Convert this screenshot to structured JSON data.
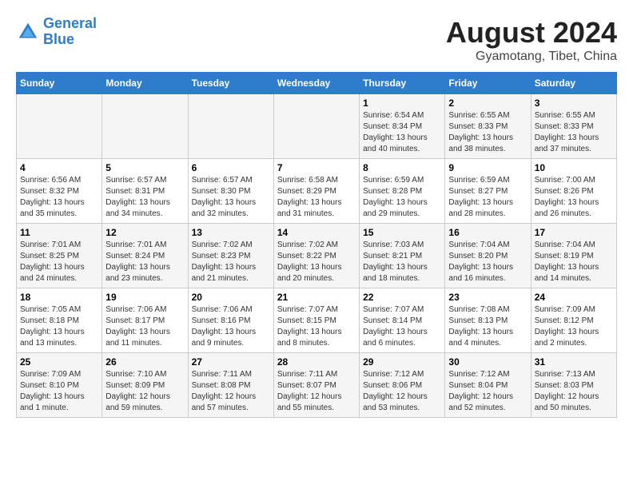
{
  "logo": {
    "line1": "General",
    "line2": "Blue"
  },
  "title": "August 2024",
  "subtitle": "Gyamotang, Tibet, China",
  "weekdays": [
    "Sunday",
    "Monday",
    "Tuesday",
    "Wednesday",
    "Thursday",
    "Friday",
    "Saturday"
  ],
  "weeks": [
    [
      {
        "day": "",
        "content": ""
      },
      {
        "day": "",
        "content": ""
      },
      {
        "day": "",
        "content": ""
      },
      {
        "day": "",
        "content": ""
      },
      {
        "day": "1",
        "content": "Sunrise: 6:54 AM\nSunset: 8:34 PM\nDaylight: 13 hours and 40 minutes."
      },
      {
        "day": "2",
        "content": "Sunrise: 6:55 AM\nSunset: 8:33 PM\nDaylight: 13 hours and 38 minutes."
      },
      {
        "day": "3",
        "content": "Sunrise: 6:55 AM\nSunset: 8:33 PM\nDaylight: 13 hours and 37 minutes."
      }
    ],
    [
      {
        "day": "4",
        "content": "Sunrise: 6:56 AM\nSunset: 8:32 PM\nDaylight: 13 hours and 35 minutes."
      },
      {
        "day": "5",
        "content": "Sunrise: 6:57 AM\nSunset: 8:31 PM\nDaylight: 13 hours and 34 minutes."
      },
      {
        "day": "6",
        "content": "Sunrise: 6:57 AM\nSunset: 8:30 PM\nDaylight: 13 hours and 32 minutes."
      },
      {
        "day": "7",
        "content": "Sunrise: 6:58 AM\nSunset: 8:29 PM\nDaylight: 13 hours and 31 minutes."
      },
      {
        "day": "8",
        "content": "Sunrise: 6:59 AM\nSunset: 8:28 PM\nDaylight: 13 hours and 29 minutes."
      },
      {
        "day": "9",
        "content": "Sunrise: 6:59 AM\nSunset: 8:27 PM\nDaylight: 13 hours and 28 minutes."
      },
      {
        "day": "10",
        "content": "Sunrise: 7:00 AM\nSunset: 8:26 PM\nDaylight: 13 hours and 26 minutes."
      }
    ],
    [
      {
        "day": "11",
        "content": "Sunrise: 7:01 AM\nSunset: 8:25 PM\nDaylight: 13 hours and 24 minutes."
      },
      {
        "day": "12",
        "content": "Sunrise: 7:01 AM\nSunset: 8:24 PM\nDaylight: 13 hours and 23 minutes."
      },
      {
        "day": "13",
        "content": "Sunrise: 7:02 AM\nSunset: 8:23 PM\nDaylight: 13 hours and 21 minutes."
      },
      {
        "day": "14",
        "content": "Sunrise: 7:02 AM\nSunset: 8:22 PM\nDaylight: 13 hours and 20 minutes."
      },
      {
        "day": "15",
        "content": "Sunrise: 7:03 AM\nSunset: 8:21 PM\nDaylight: 13 hours and 18 minutes."
      },
      {
        "day": "16",
        "content": "Sunrise: 7:04 AM\nSunset: 8:20 PM\nDaylight: 13 hours and 16 minutes."
      },
      {
        "day": "17",
        "content": "Sunrise: 7:04 AM\nSunset: 8:19 PM\nDaylight: 13 hours and 14 minutes."
      }
    ],
    [
      {
        "day": "18",
        "content": "Sunrise: 7:05 AM\nSunset: 8:18 PM\nDaylight: 13 hours and 13 minutes."
      },
      {
        "day": "19",
        "content": "Sunrise: 7:06 AM\nSunset: 8:17 PM\nDaylight: 13 hours and 11 minutes."
      },
      {
        "day": "20",
        "content": "Sunrise: 7:06 AM\nSunset: 8:16 PM\nDaylight: 13 hours and 9 minutes."
      },
      {
        "day": "21",
        "content": "Sunrise: 7:07 AM\nSunset: 8:15 PM\nDaylight: 13 hours and 8 minutes."
      },
      {
        "day": "22",
        "content": "Sunrise: 7:07 AM\nSunset: 8:14 PM\nDaylight: 13 hours and 6 minutes."
      },
      {
        "day": "23",
        "content": "Sunrise: 7:08 AM\nSunset: 8:13 PM\nDaylight: 13 hours and 4 minutes."
      },
      {
        "day": "24",
        "content": "Sunrise: 7:09 AM\nSunset: 8:12 PM\nDaylight: 13 hours and 2 minutes."
      }
    ],
    [
      {
        "day": "25",
        "content": "Sunrise: 7:09 AM\nSunset: 8:10 PM\nDaylight: 13 hours and 1 minute."
      },
      {
        "day": "26",
        "content": "Sunrise: 7:10 AM\nSunset: 8:09 PM\nDaylight: 12 hours and 59 minutes."
      },
      {
        "day": "27",
        "content": "Sunrise: 7:11 AM\nSunset: 8:08 PM\nDaylight: 12 hours and 57 minutes."
      },
      {
        "day": "28",
        "content": "Sunrise: 7:11 AM\nSunset: 8:07 PM\nDaylight: 12 hours and 55 minutes."
      },
      {
        "day": "29",
        "content": "Sunrise: 7:12 AM\nSunset: 8:06 PM\nDaylight: 12 hours and 53 minutes."
      },
      {
        "day": "30",
        "content": "Sunrise: 7:12 AM\nSunset: 8:04 PM\nDaylight: 12 hours and 52 minutes."
      },
      {
        "day": "31",
        "content": "Sunrise: 7:13 AM\nSunset: 8:03 PM\nDaylight: 12 hours and 50 minutes."
      }
    ]
  ]
}
